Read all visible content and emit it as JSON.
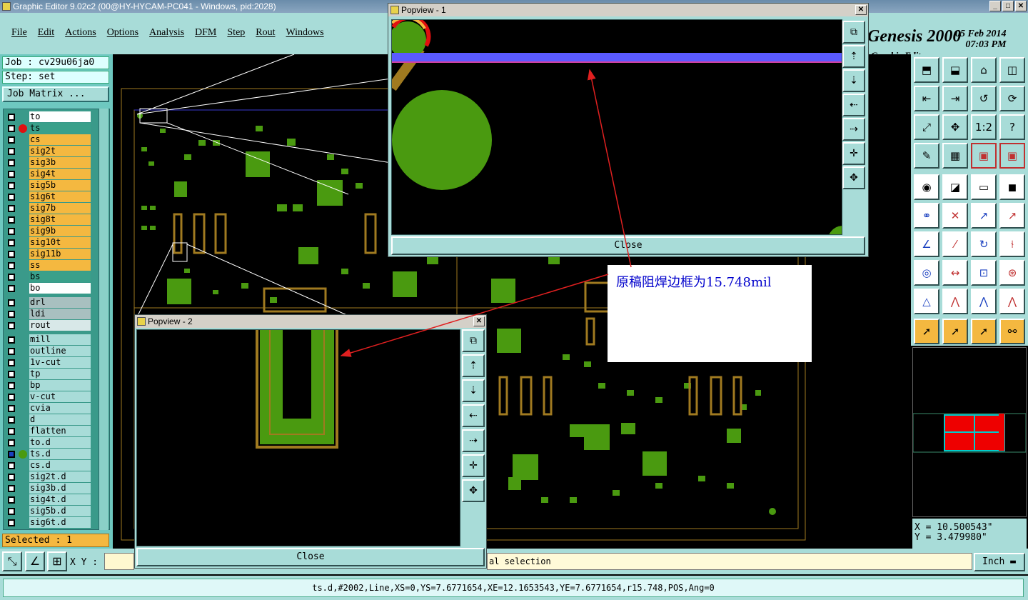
{
  "window": {
    "title": "Graphic Editor 9.02c2 (00@HY-HYCAM-PC041 - Windows, pid:2028)",
    "min": "_",
    "max": "□",
    "close": "✕"
  },
  "menu": [
    "File",
    "Edit",
    "Actions",
    "Options",
    "Analysis",
    "DFM",
    "Step",
    "Rout",
    "Windows"
  ],
  "brand": {
    "name": "Genesis 2000",
    "date": "05 Feb 2014",
    "time": "07:03 PM",
    "subtitle": "Graphic Editor"
  },
  "job": {
    "job_line": "Job : cv29u06ja0",
    "step_line": "Step: set",
    "matrix_button": "Job Matrix ..."
  },
  "layers": [
    {
      "name": "to",
      "color": "#ffffff"
    },
    {
      "name": "ts",
      "color": "#3aa08a",
      "marker": "red"
    },
    {
      "name": "cs",
      "color": "#f4b840"
    },
    {
      "name": "sig2t",
      "color": "#f4b840"
    },
    {
      "name": "sig3b",
      "color": "#f4b840"
    },
    {
      "name": "sig4t",
      "color": "#f4b840"
    },
    {
      "name": "sig5b",
      "color": "#f4b840"
    },
    {
      "name": "sig6t",
      "color": "#f4b840"
    },
    {
      "name": "sig7b",
      "color": "#f4b840"
    },
    {
      "name": "sig8t",
      "color": "#f4b840"
    },
    {
      "name": "sig9b",
      "color": "#f4b840"
    },
    {
      "name": "sig10t",
      "color": "#f4b840"
    },
    {
      "name": "sig11b",
      "color": "#f4b840"
    },
    {
      "name": "ss",
      "color": "#f4b840"
    },
    {
      "name": "bs",
      "color": "#3aa08a"
    },
    {
      "name": "bo",
      "color": "#ffffff"
    },
    {
      "name": "drl",
      "color": "#a8c0c0"
    },
    {
      "name": "ldi",
      "color": "#a8c0c0"
    },
    {
      "name": "rout",
      "color": "#d8e8e8"
    },
    {
      "name": "mill",
      "color": "#a8dcd8"
    },
    {
      "name": "outline",
      "color": "#a8dcd8"
    },
    {
      "name": "1v-cut",
      "color": "#a8dcd8"
    },
    {
      "name": "tp",
      "color": "#a8dcd8"
    },
    {
      "name": "bp",
      "color": "#a8dcd8"
    },
    {
      "name": "v-cut",
      "color": "#a8dcd8"
    },
    {
      "name": "cvia",
      "color": "#a8dcd8"
    },
    {
      "name": "d",
      "color": "#a8dcd8"
    },
    {
      "name": "flatten",
      "color": "#a8dcd8"
    },
    {
      "name": "to.d",
      "color": "#a8dcd8"
    },
    {
      "name": "ts.d",
      "color": "#a8dcd8",
      "marker": "green"
    },
    {
      "name": "cs.d",
      "color": "#a8dcd8"
    },
    {
      "name": "sig2t.d",
      "color": "#a8dcd8"
    },
    {
      "name": "sig3b.d",
      "color": "#a8dcd8"
    },
    {
      "name": "sig4t.d",
      "color": "#a8dcd8"
    },
    {
      "name": "sig5b.d",
      "color": "#a8dcd8"
    },
    {
      "name": "sig6t.d",
      "color": "#a8dcd8"
    }
  ],
  "selected": "Selected : 1",
  "xy_label": "X Y :",
  "message": "al selection",
  "unit": "Inch",
  "coords": {
    "x": "X = 10.500543\"",
    "y": "Y = 3.479980\""
  },
  "info": "ts.d,#2002,Line,XS=0,YS=7.6771654,XE=12.1653543,YE=7.6771654,r15.748,POS,Ang=0",
  "popview1": {
    "title": "Popview - 1",
    "close": "Close"
  },
  "popview2": {
    "title": "Popview - 2",
    "close": "Close"
  },
  "note": "原稿阻焊边框为15.748mil",
  "colors": {
    "panel": "#a8dcd8",
    "copper": "#4a9a10",
    "outline": "#a07a20",
    "highlight": "#5a5aff",
    "annotation": "#0000cc",
    "arrow": "#e02020"
  }
}
